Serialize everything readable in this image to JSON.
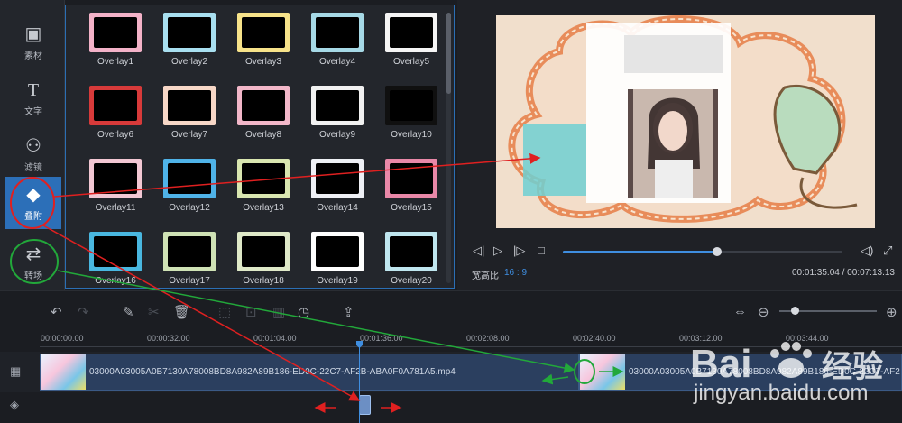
{
  "sidebar": {
    "items": [
      {
        "label": "素材",
        "icon": "media-icon"
      },
      {
        "label": "文字",
        "icon": "text-icon"
      },
      {
        "label": "滤镜",
        "icon": "filter-icon"
      },
      {
        "label": "叠附",
        "icon": "overlay-icon"
      },
      {
        "label": "转场",
        "icon": "transition-icon"
      }
    ],
    "active_index": 3
  },
  "overlays": [
    {
      "name": "Overlay1",
      "frame": "#f3b2c8"
    },
    {
      "name": "Overlay2",
      "frame": "#a8dff0"
    },
    {
      "name": "Overlay3",
      "frame": "#f7e38a"
    },
    {
      "name": "Overlay4",
      "frame": "#a6d9e6"
    },
    {
      "name": "Overlay5",
      "frame": "#f5f5f5"
    },
    {
      "name": "Overlay6",
      "frame": "#d73a3a"
    },
    {
      "name": "Overlay7",
      "frame": "#f7d7c7"
    },
    {
      "name": "Overlay8",
      "frame": "#f2b7c9"
    },
    {
      "name": "Overlay9",
      "frame": "#f1f1f1"
    },
    {
      "name": "Overlay10",
      "frame": "#101010"
    },
    {
      "name": "Overlay11",
      "frame": "#f2c7d3"
    },
    {
      "name": "Overlay12",
      "frame": "#4fb3e8"
    },
    {
      "name": "Overlay13",
      "frame": "#d9e6b0"
    },
    {
      "name": "Overlay14",
      "frame": "#eef0f5"
    },
    {
      "name": "Overlay15",
      "frame": "#e988a8"
    },
    {
      "name": "Overlay16",
      "frame": "#49b7e0"
    },
    {
      "name": "Overlay17",
      "frame": "#cfe2b5"
    },
    {
      "name": "Overlay18",
      "frame": "#dfe9c8"
    },
    {
      "name": "Overlay19",
      "frame": "#ffffff"
    },
    {
      "name": "Overlay20",
      "frame": "#bfe6ef"
    }
  ],
  "player": {
    "aspect_label": "宽高比",
    "aspect_value": "16 : 9",
    "timecode": "00:01:35.04 / 00:07:13.13",
    "progress": 0.55,
    "controls": [
      "prev-frame-icon",
      "play-icon",
      "next-frame-icon",
      "stop-icon",
      "volume-icon",
      "fullscreen-icon"
    ]
  },
  "toolbar": {
    "zoom_level": 0.12
  },
  "timeline": {
    "ticks": [
      "00:00:00.00",
      "00:00:32.00",
      "00:01:04.00",
      "00:01:36.00",
      "00:02:08.00",
      "00:02:40.00",
      "00:03:12.00",
      "00:03:44.00"
    ],
    "clips": [
      {
        "name": "03000A03005A0B7130A78008BD8A982A89B186-ED0C-22C7-AF2B-ABA0F0A781A5.mp4"
      },
      {
        "name": "03000A03005A0B7130A78008BD8A982A89B186-ED0C-22C7-AF2"
      }
    ]
  },
  "watermark": {
    "text": "Bai 经验",
    "url": "jingyan.baidu.com"
  },
  "colors": {
    "accent": "#3f8ee0",
    "annotation_red": "#e02020",
    "annotation_green": "#22a83a"
  }
}
